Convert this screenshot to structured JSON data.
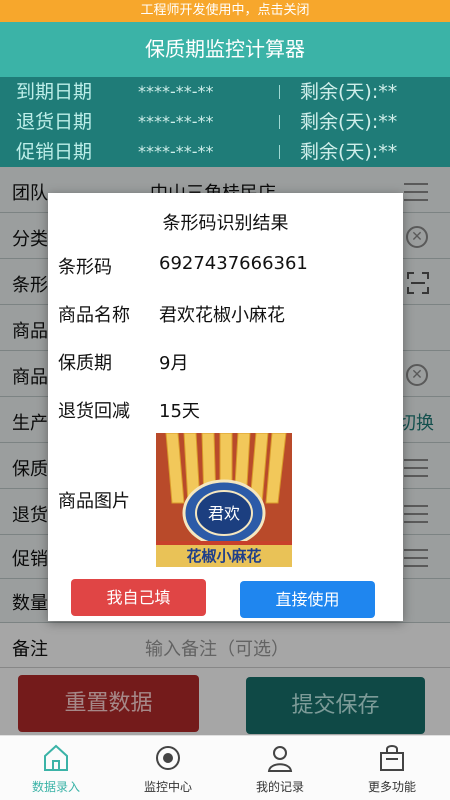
{
  "dev_banner": "工程师开发使用中，点击关闭",
  "app_title": "保质期监控计算器",
  "summary": {
    "rows": [
      {
        "label": "到期日期",
        "value": "****-**-**",
        "remaining": "剩余(天):**"
      },
      {
        "label": "退货日期",
        "value": "****-**-**",
        "remaining": "剩余(天):**"
      },
      {
        "label": "促销日期",
        "value": "****-**-**",
        "remaining": "剩余(天):**"
      }
    ]
  },
  "form": {
    "team_label": "团队",
    "team_value": "中山三角桂民店",
    "category_label": "分类",
    "barcode_label": "条形",
    "product_label": "商品",
    "product2_label": "商品",
    "production_label": "生产",
    "switch_label": "切换",
    "shelf_label": "保质",
    "return_label": "退货",
    "promo_label": "促销",
    "qty_label": "数量",
    "remark_label": "备注",
    "remark_placeholder": "输入备注（可选）"
  },
  "dialog": {
    "title": "条形码识别结果",
    "barcode_label": "条形码",
    "barcode_value": "6927437666361",
    "name_label": "商品名称",
    "name_value": "君欢花椒小麻花",
    "shelf_label": "保质期",
    "shelf_value": "9月",
    "return_label": "退货回减",
    "return_value": "15天",
    "image_label": "商品图片",
    "image_brand": "君欢",
    "image_text": "花椒小麻花",
    "self_fill": "我自己填",
    "use_direct": "直接使用"
  },
  "buttons": {
    "reset": "重置数据",
    "submit": "提交保存"
  },
  "nav": [
    {
      "label": "数据录入",
      "icon": "home-icon",
      "active": true
    },
    {
      "label": "监控中心",
      "icon": "target-icon",
      "active": false
    },
    {
      "label": "我的记录",
      "icon": "user-icon",
      "active": false
    },
    {
      "label": "更多功能",
      "icon": "bag-icon",
      "active": false
    }
  ],
  "colors": {
    "banner": "#f7a72c",
    "header": "#3bb3a7",
    "summary": "#1f7c78",
    "reset": "#b22a2a",
    "submit": "#18706c",
    "dialog_red": "#e04545",
    "dialog_blue": "#1f86ef",
    "nav_active": "#3bb3a7"
  }
}
